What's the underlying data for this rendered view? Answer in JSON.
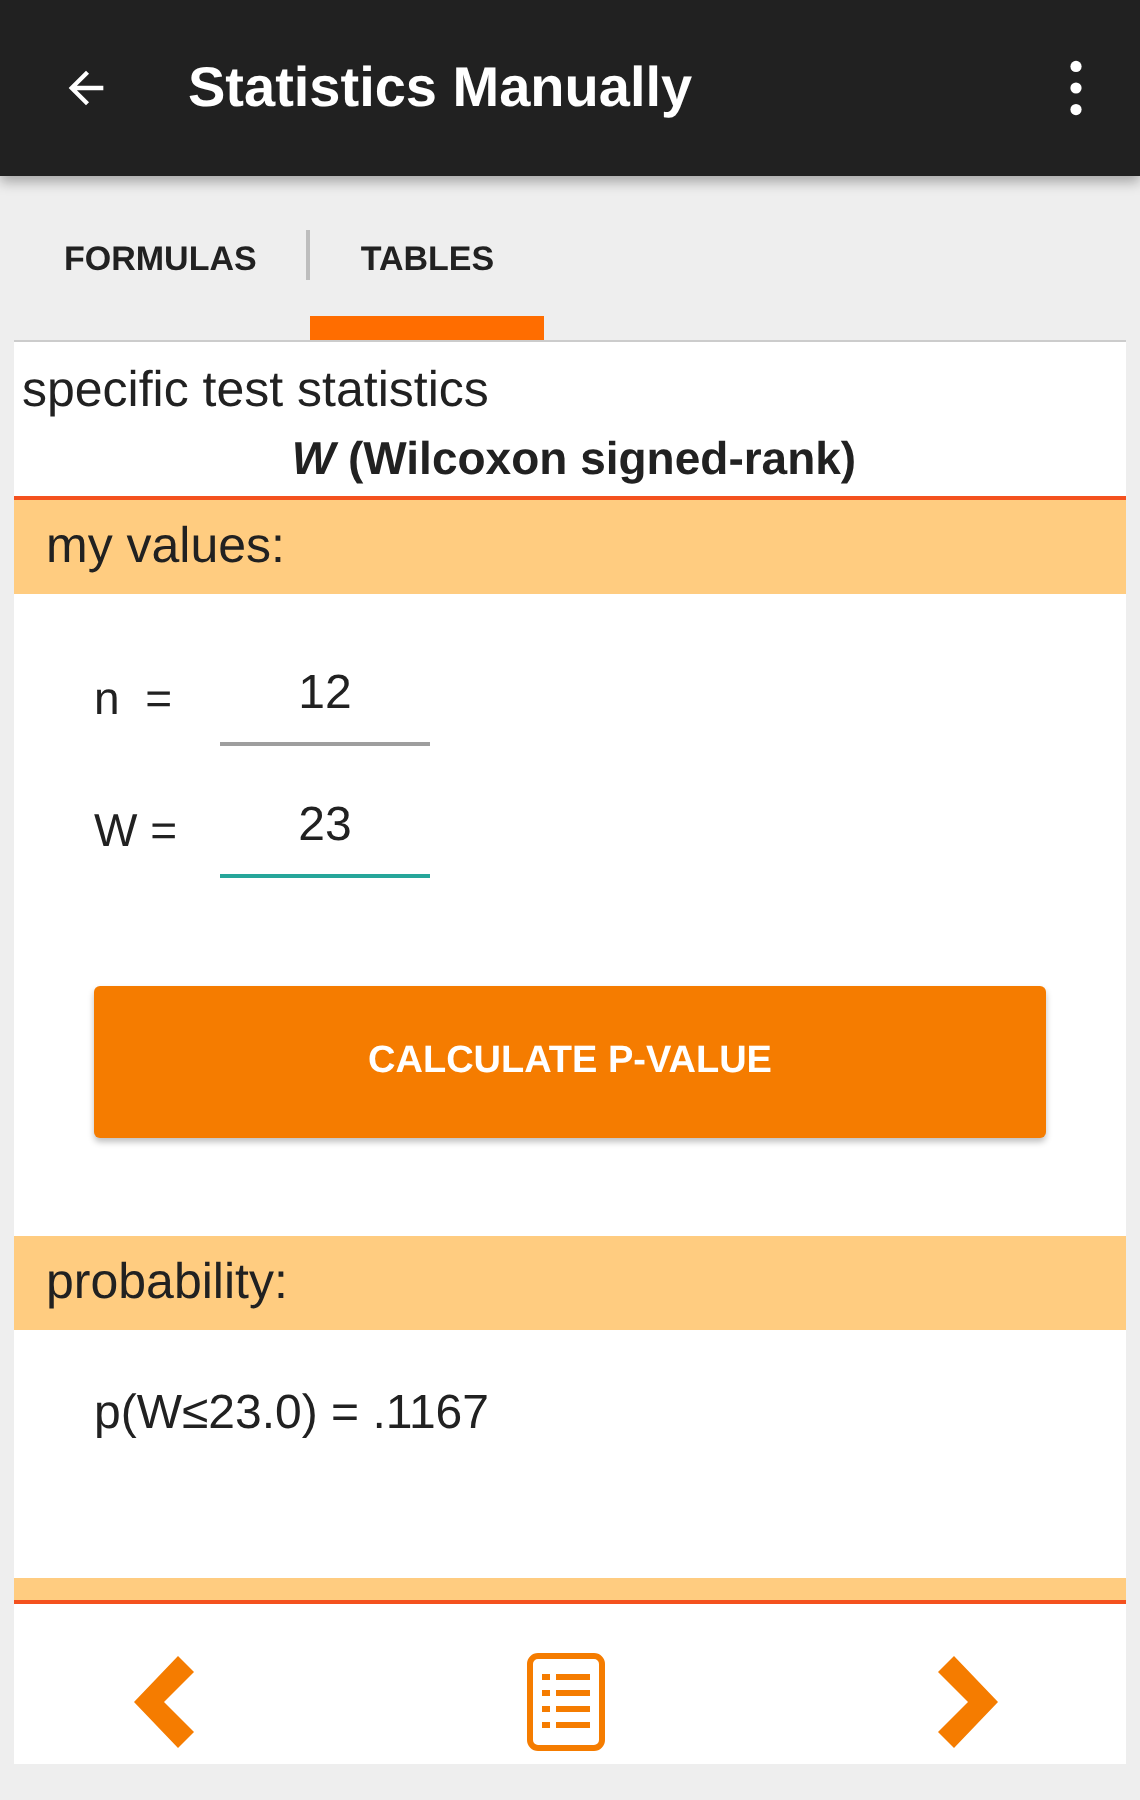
{
  "app_bar": {
    "title": "Statistics Manually"
  },
  "tabs": [
    {
      "label": "FORMULAS",
      "selected": false
    },
    {
      "label": "TABLES",
      "selected": true
    }
  ],
  "heading": {
    "title": "specific test statistics",
    "subtitle": "*W* (Wilcoxon signed-rank)"
  },
  "values_section": {
    "label": "my values:",
    "fields": [
      {
        "label": "n  =",
        "value": "12",
        "focused": false
      },
      {
        "label": "W =",
        "value": "23",
        "focused": true
      }
    ]
  },
  "calculate_button": "CALCULATE P-VALUE",
  "probability_section": {
    "label": "probability:",
    "result": "p(W≤23.0) = .1167"
  }
}
